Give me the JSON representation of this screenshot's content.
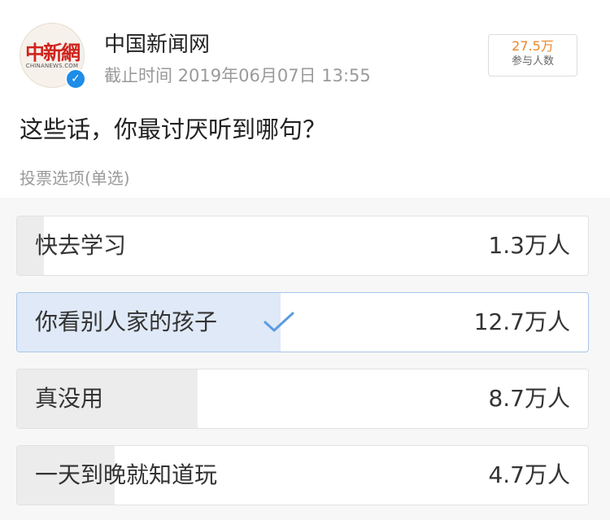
{
  "account": {
    "logo_text": "中新網",
    "logo_subtext": "CHINANEWS.COM",
    "name": "中国新闻网",
    "verified_mark": "✓"
  },
  "deadline": "截止时间 2019年06月07日 13:55",
  "participants": {
    "count": "27.5万",
    "label": "参与人数"
  },
  "question": "这些话，你最讨厌听到哪句？",
  "vote_type": "投票选项(单选)",
  "options": [
    {
      "label": "快去学习",
      "votes": "1.3万人",
      "share": 0.047,
      "selected": false
    },
    {
      "label": "你看别人家的孩子",
      "votes": "12.7万人",
      "share": 0.462,
      "selected": true,
      "icon": "check-icon"
    },
    {
      "label": "真没用",
      "votes": "8.7万人",
      "share": 0.316,
      "selected": false
    },
    {
      "label": "一天到晚就知道玩",
      "votes": "4.7万人",
      "share": 0.171,
      "selected": false
    }
  ],
  "colors": {
    "accent": "#1d8de8",
    "participants_count": "#e8872a",
    "selected_fill": "#dfe9f7",
    "default_fill": "#ececec",
    "check": "#5b9be0"
  }
}
